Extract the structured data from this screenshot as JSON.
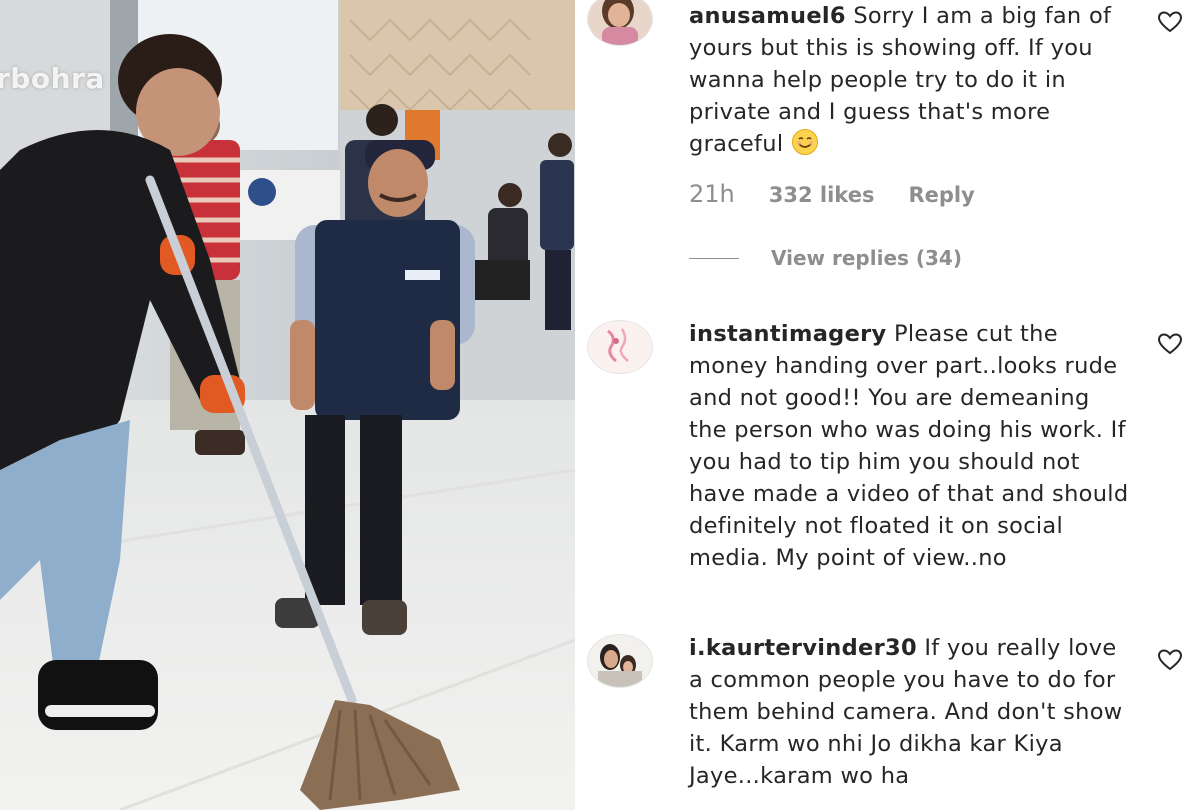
{
  "media": {
    "watermark": "rbohra",
    "colors": {
      "sky": "#e8ecef",
      "floor": "#eceeee",
      "wall": "#bfc4c6",
      "jacket": "#1b1b1d",
      "jeans": "#8eaecb",
      "vest": "#1f2a44",
      "shirt": "#aab7cf",
      "stripes": "#c8303a",
      "mop_handle": "#c9cfd6",
      "mop_head": "#8a6f55",
      "glove": "#e25a23"
    }
  },
  "comments": [
    {
      "username": "anusamuel6",
      "text": "Sorry I am a big fan of yours but this is showing off. If you wanna help people try to do it in private and I guess that's more graceful",
      "emoji": "smiling-face",
      "time": "21h",
      "likes": "332 likes",
      "reply_label": "Reply",
      "view_replies": "View replies (34)"
    },
    {
      "username": "instantimagery",
      "text": "Please cut the money handing over part..looks rude and not good!! You are demeaning the person who was doing his work. If you had to tip him you should not have made a video of that and should definitely not floated it on social media. My point of view..no"
    },
    {
      "username": "i.kaurtervinder30",
      "text": "If you really love a common people you have to do for them behind camera. And don't show it. Karm wo nhi Jo dikha kar Kiya Jaye...karam wo ha"
    }
  ],
  "ui": {
    "heart_icon": "heart-outline-icon",
    "accent": "#262626",
    "muted": "#8e8e8e"
  }
}
